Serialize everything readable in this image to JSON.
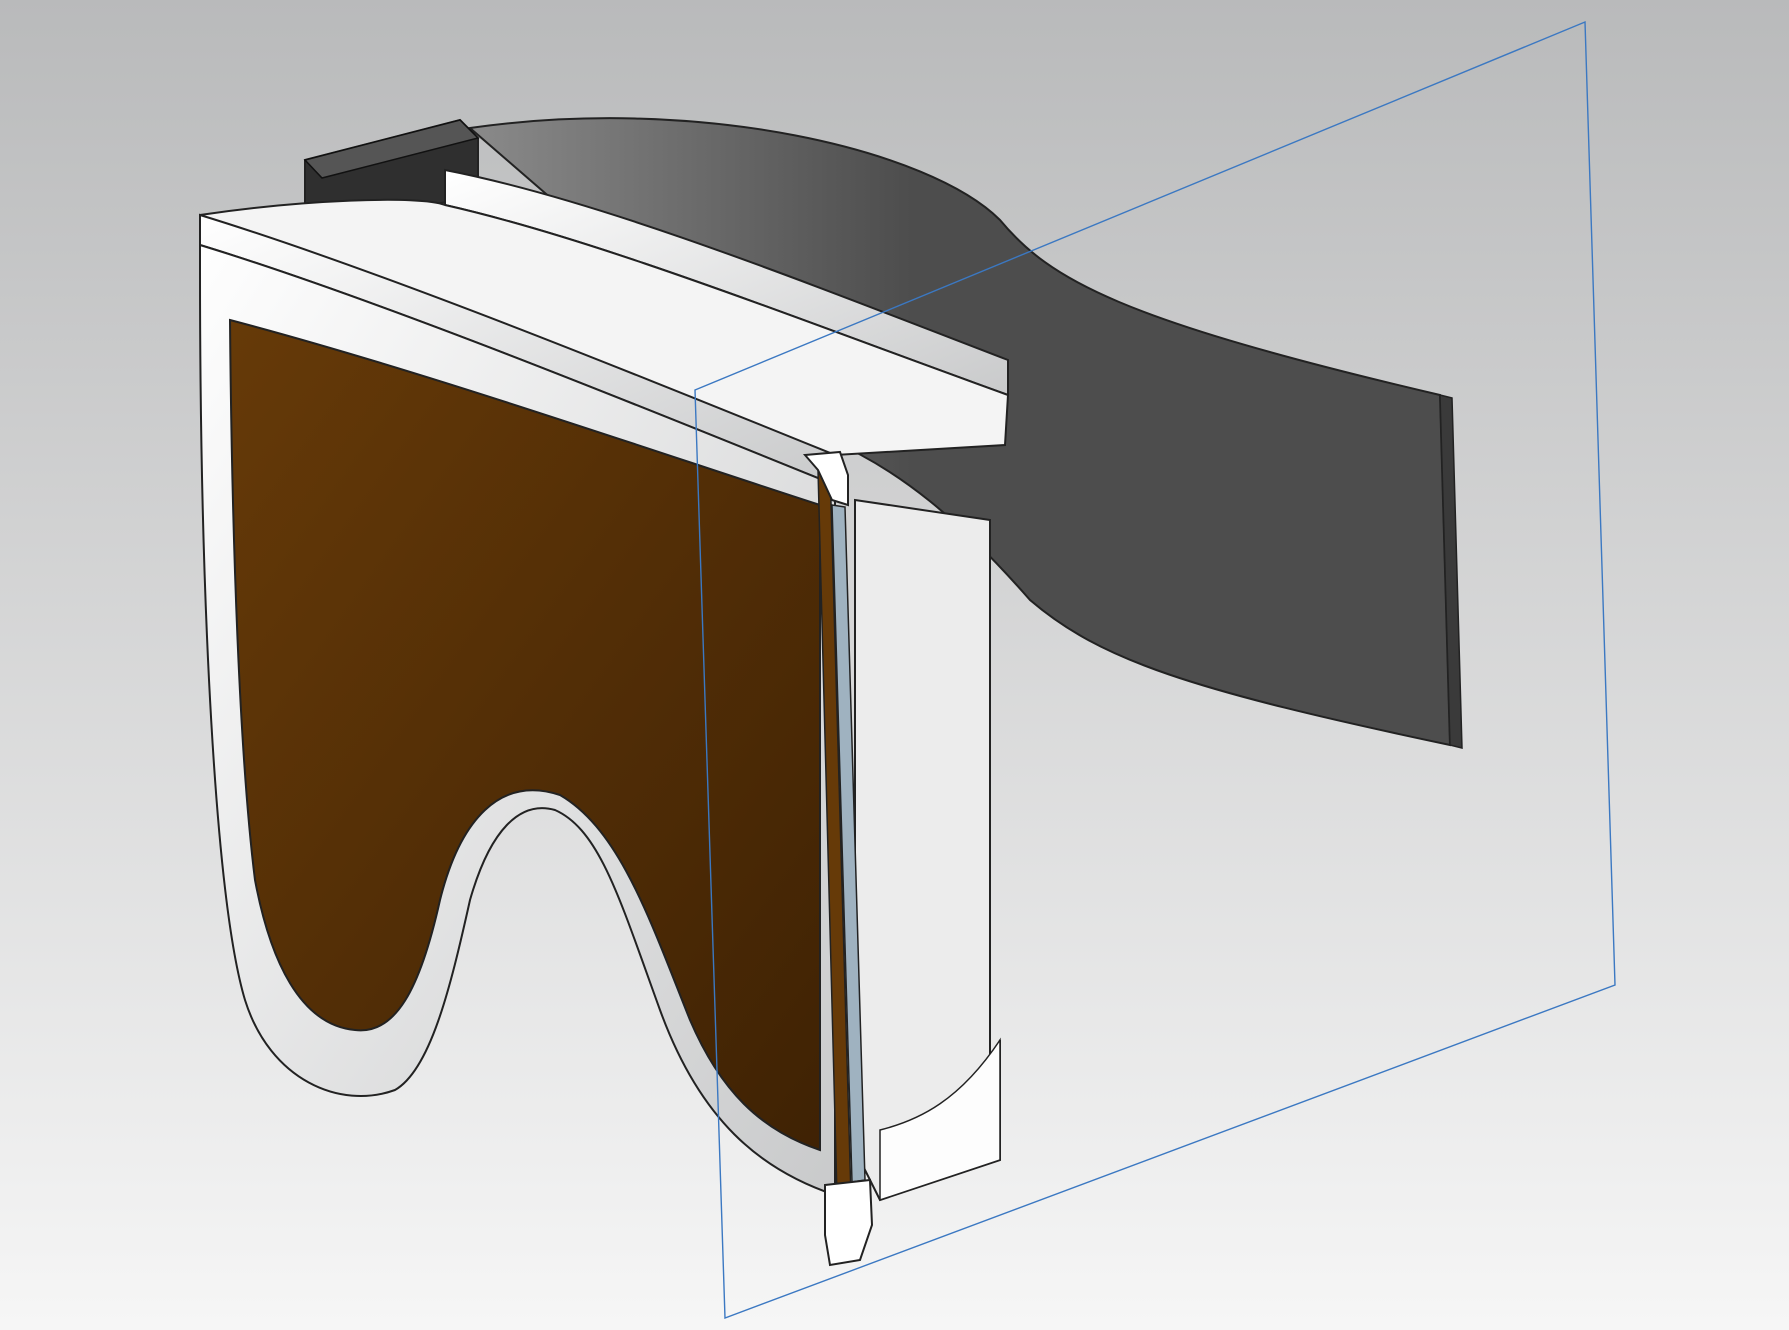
{
  "viewport": {
    "background_top": "#b9babb",
    "background_bottom": "#f6f6f6"
  },
  "model": {
    "frame_color": "#f4f4f4",
    "frame_shadow": "#c9cacb",
    "lens_color": "#663a08",
    "lens_edge": "#3f2204",
    "strap_light": "#8a8a8a",
    "strap_dark": "#4d4d4d",
    "clip_color": "#2f2f2f",
    "inner_lens_color": "#9fb2c0",
    "edge_color": "#222222"
  },
  "section_plane": {
    "line_color": "#3b78c2"
  }
}
